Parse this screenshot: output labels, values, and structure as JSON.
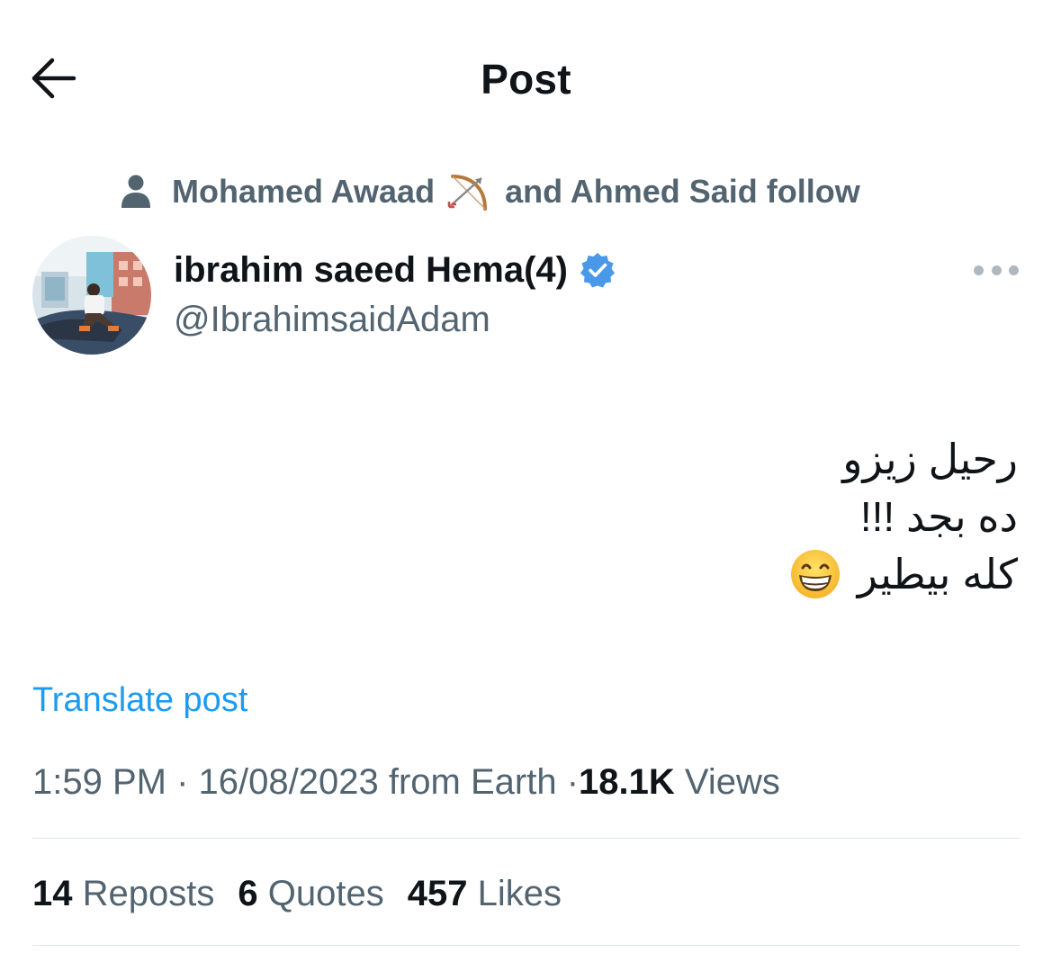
{
  "header": {
    "title": "Post",
    "back_icon": "arrow-left-icon"
  },
  "social_context": {
    "icon": "person-icon",
    "name_1": "Mohamed Awaad",
    "emoji": "bow-and-arrow",
    "rest": "and Ahmed Said follow"
  },
  "author": {
    "name": "ibrahim saeed Hema(4)",
    "handle": "@IbrahimsaidAdam",
    "verified": true,
    "verified_color": "#4a99e9"
  },
  "tweet": {
    "lines": [
      "رحيل زيزو",
      "ده بجد !!!",
      "كله بيطير"
    ],
    "trailing_emoji": "grinning-face-with-smiling-eyes"
  },
  "translate": {
    "label": "Translate post"
  },
  "meta": {
    "time": "1:59 PM",
    "separator": "·",
    "date": "16/08/2023",
    "source": "from Earth",
    "views_count": "18.1K",
    "views_label": "Views"
  },
  "stats": {
    "reposts_count": "14",
    "reposts_label": "Reposts",
    "quotes_count": "6",
    "quotes_label": "Quotes",
    "likes_count": "457",
    "likes_label": "Likes"
  },
  "colors": {
    "text_primary": "#0f1419",
    "text_secondary": "#536471",
    "link": "#1d9bf0",
    "divider": "#e1e5e8"
  }
}
